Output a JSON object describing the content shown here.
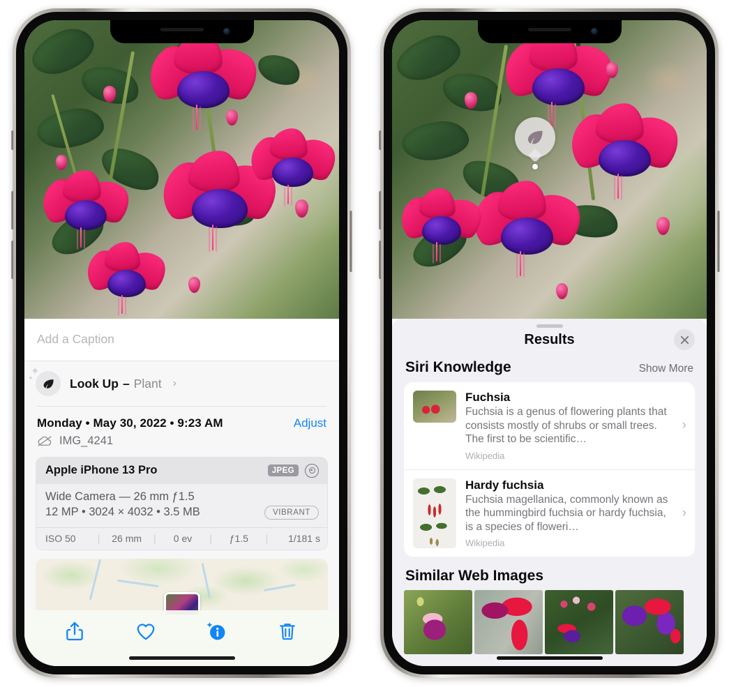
{
  "left_phone": {
    "name": "photo-details-screen",
    "caption_placeholder": "Add a Caption",
    "lookup": {
      "icon": "leaf-icon",
      "label": "Look Up",
      "separator": "–",
      "subject": "Plant",
      "chevron": "›"
    },
    "date_line": "Monday • May 30, 2022 • 9:23 AM",
    "adjust_label": "Adjust",
    "cloud_icon": "cloud-slash-icon",
    "file_name": "IMG_4241",
    "exif": {
      "device": "Apple iPhone 13 Pro",
      "format_tag": "JPEG",
      "raw_icon": "aperture-icon",
      "lens_line": "Wide Camera — 26 mm ƒ1.5",
      "spec_line": "12 MP • 3024 × 4032 • 3.5 MB",
      "style_tag": "VIBRANT",
      "stats": [
        "ISO 50",
        "26 mm",
        "0 ev",
        "ƒ1.5",
        "1/181 s"
      ],
      "divider": "|"
    },
    "toolbar": [
      {
        "name": "share-button",
        "icon": "share-icon"
      },
      {
        "name": "favorite-button",
        "icon": "heart-icon"
      },
      {
        "name": "info-button",
        "icon": "info-sparkle-icon"
      },
      {
        "name": "delete-button",
        "icon": "trash-icon"
      }
    ]
  },
  "right_phone": {
    "name": "visual-lookup-results-screen",
    "pin_icon": "leaf-icon",
    "sheet": {
      "title": "Results",
      "close_icon": "close-icon",
      "siri_section": {
        "title": "Siri Knowledge",
        "show_more": "Show More",
        "cards": [
          {
            "title": "Fuchsia",
            "description": "Fuchsia is a genus of flowering plants that consists mostly of shrubs or small trees. The first to be scientific…",
            "source": "Wikipedia",
            "chevron": "›"
          },
          {
            "title": "Hardy fuchsia",
            "description": "Fuchsia magellanica, commonly known as the hummingbird fuchsia or hardy fuchsia, is a species of floweri…",
            "source": "Wikipedia",
            "chevron": "›"
          }
        ]
      },
      "web_section": {
        "title": "Similar Web Images",
        "thumbnails": [
          "web-image-1",
          "web-image-2",
          "web-image-3",
          "web-image-4"
        ]
      }
    }
  },
  "colors": {
    "accent_blue": "#1285f7",
    "sheet_bg": "#f1f0f5",
    "info_bg": "#f7f7f8",
    "card_bg": "#ffffff",
    "secondary_text": "#75757b"
  }
}
